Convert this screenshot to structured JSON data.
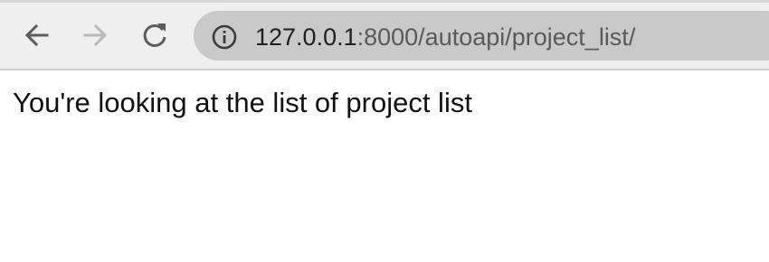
{
  "browser": {
    "back_icon": "arrow-left-icon",
    "forward_icon": "arrow-right-icon",
    "reload_icon": "reload-icon",
    "info_icon": "info-icon",
    "address": {
      "host": "127.0.0.1",
      "port_and_path": ":8000/autoapi/project_list/"
    },
    "colors": {
      "toolbar": "#efefef",
      "omnibox": "#c9c9c9",
      "forward_disabled": "#b9b9b9"
    }
  },
  "page": {
    "message": "You're looking at the list of project list"
  }
}
